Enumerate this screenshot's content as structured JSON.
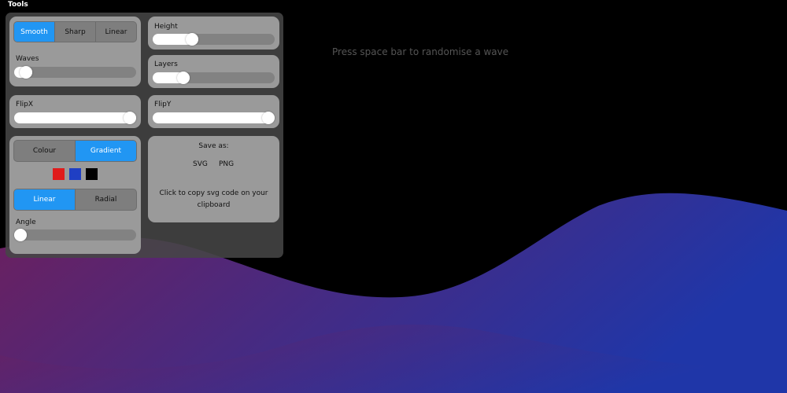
{
  "header": {
    "title": "Tools"
  },
  "hint": "Press space bar to randomise a wave",
  "curve": {
    "options": [
      "Smooth",
      "Sharp",
      "Linear"
    ],
    "selected": "Smooth"
  },
  "waves": {
    "label": "Waves",
    "value": 0.05
  },
  "height": {
    "label": "Height",
    "value": 0.3
  },
  "layers": {
    "label": "Layers",
    "value": 0.22
  },
  "flipx": {
    "label": "FlipX",
    "value": 1.0
  },
  "flipy": {
    "label": "FlipY",
    "value": 1.0
  },
  "fill_mode": {
    "options": [
      "Colour",
      "Gradient"
    ],
    "selected": "Gradient"
  },
  "swatches": [
    "#e01b1b",
    "#1f3fc4",
    "#000000"
  ],
  "gradient_type": {
    "options": [
      "Linear",
      "Radial"
    ],
    "selected": "Linear"
  },
  "angle": {
    "label": "Angle",
    "value": 0.0
  },
  "save": {
    "title": "Save as:",
    "svg": "SVG",
    "png": "PNG",
    "copy": "Click to copy svg code on your clipboard"
  },
  "colors": {
    "accent": "#2196f3",
    "wave_start": "#6e1f5c",
    "wave_end": "#1f36a8"
  }
}
